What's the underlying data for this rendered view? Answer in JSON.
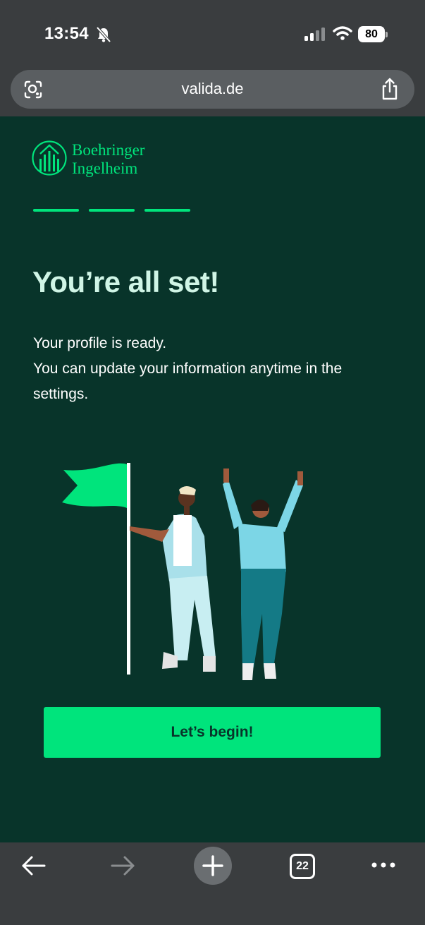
{
  "status_bar": {
    "time": "13:54",
    "battery": "80",
    "icons": [
      "bell-muted-icon",
      "signal-icon",
      "wifi-icon",
      "battery-icon"
    ]
  },
  "browser": {
    "url": "valida.de",
    "tab_count": "22",
    "icons": [
      "lens-icon",
      "share-icon",
      "back-arrow-icon",
      "forward-arrow-icon",
      "plus-icon",
      "tabs-icon",
      "more-icon"
    ]
  },
  "brand": {
    "logo_line1": "Boehringer",
    "logo_line2": "Ingelheim",
    "accent": "#00e47c",
    "background": "#08342a"
  },
  "onboarding": {
    "steps_total": 3,
    "steps_completed": 3
  },
  "content": {
    "headline": "You’re all set!",
    "line1": "Your profile is ready.",
    "line2": "You can update your information anytime in the settings.",
    "cta_label": "Let’s begin!"
  }
}
